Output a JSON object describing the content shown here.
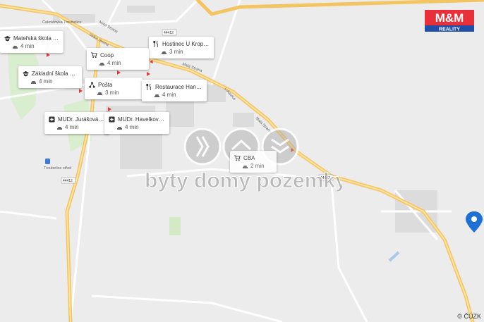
{
  "map": {
    "road_labels": [
      "Čakoldovka Troubelice",
      "Malá Strana",
      "Velká Strana",
      "Malá Strana",
      "Lukavice",
      "Malá Strana",
      "Troubelice střed"
    ],
    "road_numbers": [
      "44412",
      "44412",
      "44412"
    ],
    "copyright": "© ČÚZK",
    "colors": {
      "background": "#ececec",
      "road_main": "#f6cf7a",
      "road_secondary": "#ffffff",
      "green": "#d6ecc8",
      "water": "#a9c8ee",
      "pin": "#1f6fd4"
    }
  },
  "brand": {
    "logo_text": "M&M",
    "logo_sub": "REALITY",
    "watermark": "byty domy pozemky"
  },
  "pois": [
    {
      "icon": "school-icon",
      "name": "Mateřská škola T...",
      "time": "4 min"
    },
    {
      "icon": "restaurant-icon",
      "name": "Hostinec U Kropá...",
      "time": "3 min"
    },
    {
      "icon": "cart-icon",
      "name": "Coop",
      "time": "4 min"
    },
    {
      "icon": "school-icon",
      "name": "Základní škola Tr...",
      "time": "4 min"
    },
    {
      "icon": "post-icon",
      "name": "Pošta",
      "time": "3 min"
    },
    {
      "icon": "restaurant-icon",
      "name": "Restaurace Hana...",
      "time": "4 min"
    },
    {
      "icon": "medical-icon",
      "name": "MUDr. Jurášová A...",
      "time": "4 min"
    },
    {
      "icon": "medical-icon",
      "name": "MUDr. Havelková ...",
      "time": "4 min"
    },
    {
      "icon": "cart-icon",
      "name": "CBA",
      "time": "2 min"
    }
  ]
}
